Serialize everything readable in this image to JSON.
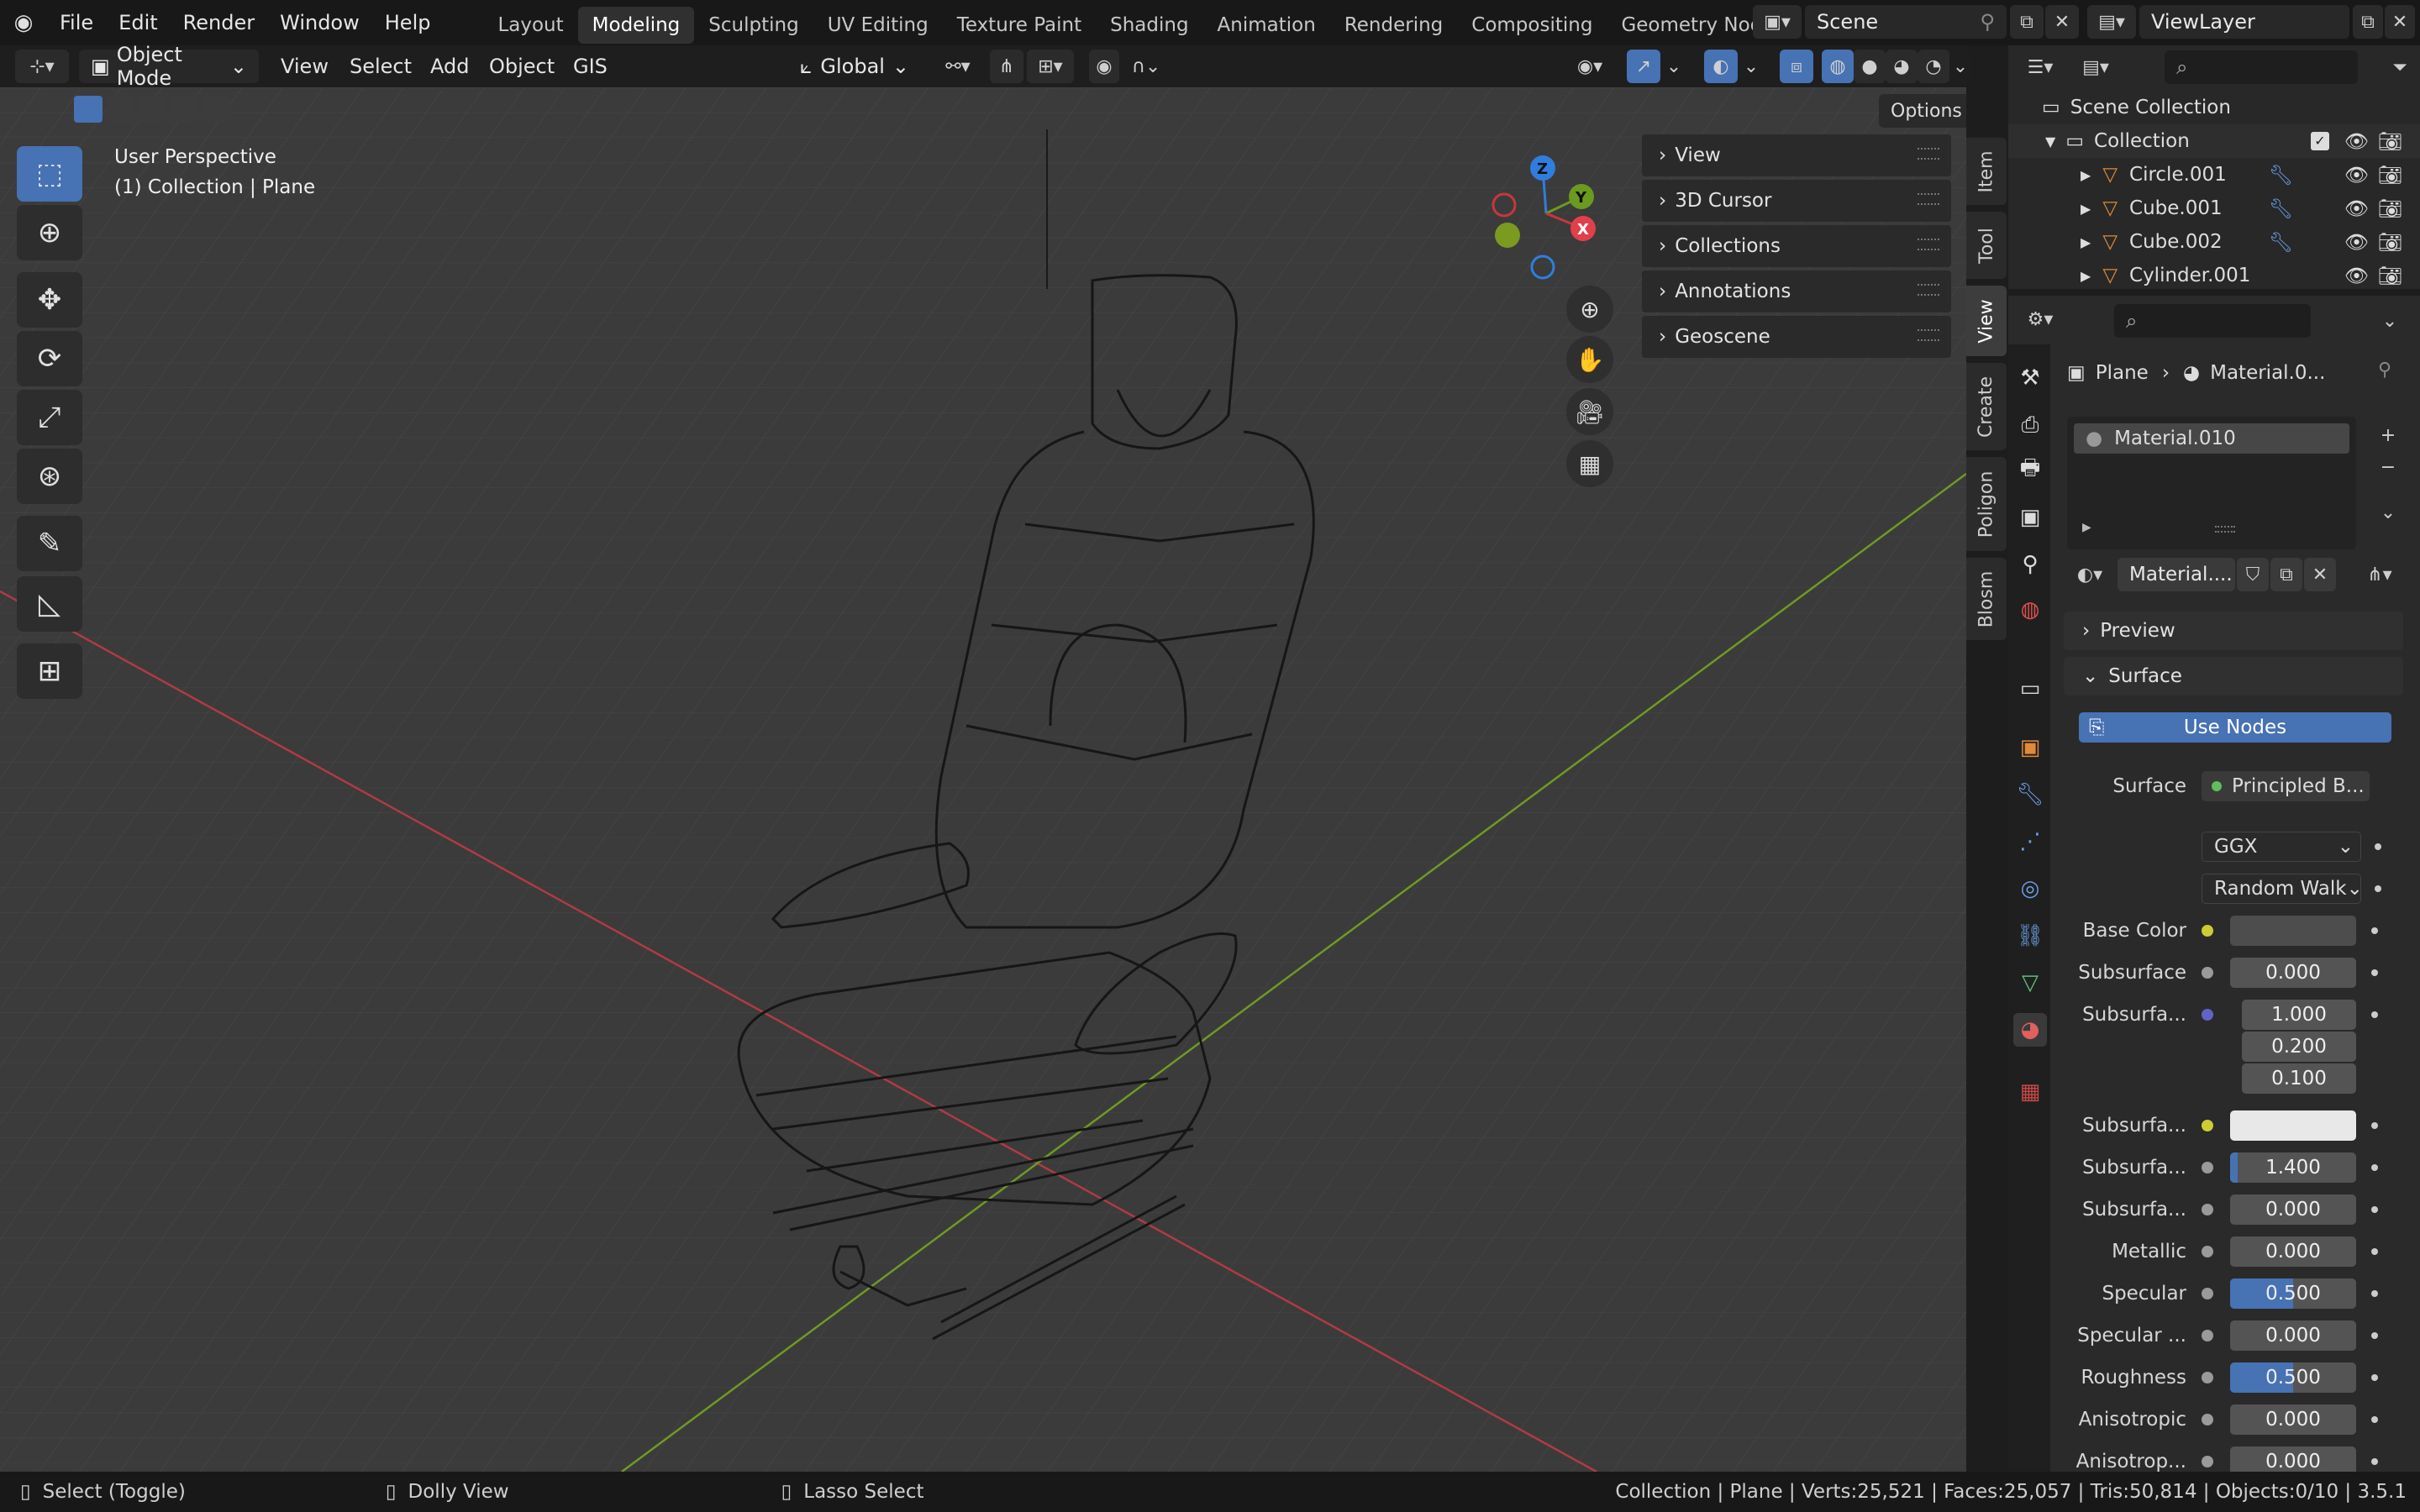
{
  "topbar": {
    "menus": [
      "File",
      "Edit",
      "Render",
      "Window",
      "Help"
    ],
    "workspaces": [
      "Layout",
      "Modeling",
      "Sculpting",
      "UV Editing",
      "Texture Paint",
      "Shading",
      "Animation",
      "Rendering",
      "Compositing",
      "Geometry Nodes"
    ],
    "active_workspace": "Modeling",
    "scene": "Scene",
    "view_layer": "ViewLayer"
  },
  "header": {
    "mode": "Object Mode",
    "menus": [
      "View",
      "Select",
      "Add",
      "Object",
      "GIS"
    ],
    "orientation": "Global",
    "options": "Options"
  },
  "viewport": {
    "overlay_line1": "User Perspective",
    "overlay_line2": "(1) Collection | Plane",
    "gizmo": {
      "x": "X",
      "y": "Y",
      "z": "Z"
    }
  },
  "npanel": {
    "sections": [
      "View",
      "3D Cursor",
      "Collections",
      "Annotations",
      "Geoscene"
    ],
    "tabs": [
      "Item",
      "Tool",
      "View",
      "Create",
      "Poligon",
      "Blosm"
    ],
    "active_tab": "View"
  },
  "outliner": {
    "root": "Scene Collection",
    "collection": "Collection",
    "objects": [
      "Circle.001",
      "Cube.001",
      "Cube.002",
      "Cylinder.001"
    ]
  },
  "properties": {
    "breadcrumb_object": "Plane",
    "breadcrumb_material": "Material.0...",
    "slot": "Material.010",
    "material_name": "Material....",
    "preview": "Preview",
    "surface_section": "Surface",
    "use_nodes": "Use Nodes",
    "surface_label": "Surface",
    "surface_shader": "Principled B...",
    "distribution": "GGX",
    "subsurface_method": "Random Walk",
    "rows": [
      {
        "label": "Base Color",
        "type": "color",
        "dot": "#cccc33",
        "color": "#4d4d4d"
      },
      {
        "label": "Subsurface",
        "value": "0.000",
        "fill": 0,
        "dot": "#9a9a9a"
      },
      {
        "label": "Subsurfa...",
        "value": "1.000",
        "dot": "#6363c7"
      },
      {
        "label": "",
        "value": "0.200"
      },
      {
        "label": "",
        "value": "0.100"
      },
      {
        "label": "Subsurfa...",
        "type": "color",
        "dot": "#cccc33",
        "color": "#e8e8e8"
      },
      {
        "label": "Subsurfa...",
        "value": "1.400",
        "fill": 0.06,
        "dot": "#9a9a9a"
      },
      {
        "label": "Subsurfa...",
        "value": "0.000",
        "fill": 0,
        "dot": "#9a9a9a"
      },
      {
        "label": "Metallic",
        "value": "0.000",
        "fill": 0,
        "dot": "#9a9a9a"
      },
      {
        "label": "Specular",
        "value": "0.500",
        "fill": 0.5,
        "dot": "#9a9a9a"
      },
      {
        "label": "Specular ...",
        "value": "0.000",
        "fill": 0,
        "dot": "#9a9a9a"
      },
      {
        "label": "Roughness",
        "value": "0.500",
        "fill": 0.5,
        "dot": "#9a9a9a"
      },
      {
        "label": "Anisotropic",
        "value": "0.000",
        "fill": 0,
        "dot": "#9a9a9a"
      },
      {
        "label": "Anisotrop...",
        "value": "0.000",
        "fill": 0,
        "dot": "#9a9a9a"
      }
    ]
  },
  "status": {
    "left1": "Select (Toggle)",
    "left2": "Dolly View",
    "left3": "Lasso Select",
    "right": "Collection | Plane | Verts:25,521 | Faces:25,057 | Tris:50,814 | Objects:0/10 | 3.5.1"
  },
  "colors": {
    "accent": "#4772b3",
    "axis_x": "#c6363f",
    "axis_y": "#6a9a1f",
    "axis_z": "#2f7ddf"
  }
}
